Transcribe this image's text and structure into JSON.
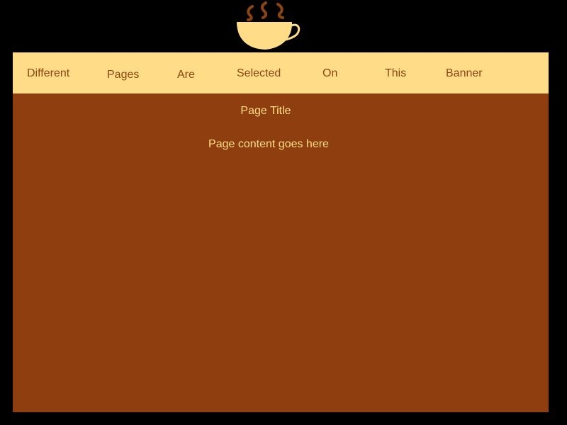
{
  "colors": {
    "background": "#000000",
    "banner": "#ffdd88",
    "banner_text": "#8b4513",
    "content_background": "#8f3e0f",
    "content_text": "#ffdd88",
    "logo_cup": "#ffdd88",
    "logo_steam": "#8b4513"
  },
  "logo": {
    "icon": "coffee-cup-icon"
  },
  "nav": {
    "items": [
      {
        "label": "Different"
      },
      {
        "label": "Pages"
      },
      {
        "label": "Are"
      },
      {
        "label": "Selected"
      },
      {
        "label": "On"
      },
      {
        "label": "This"
      },
      {
        "label": "Banner"
      }
    ]
  },
  "main": {
    "title": "Page Title",
    "content": "Page content goes here"
  }
}
